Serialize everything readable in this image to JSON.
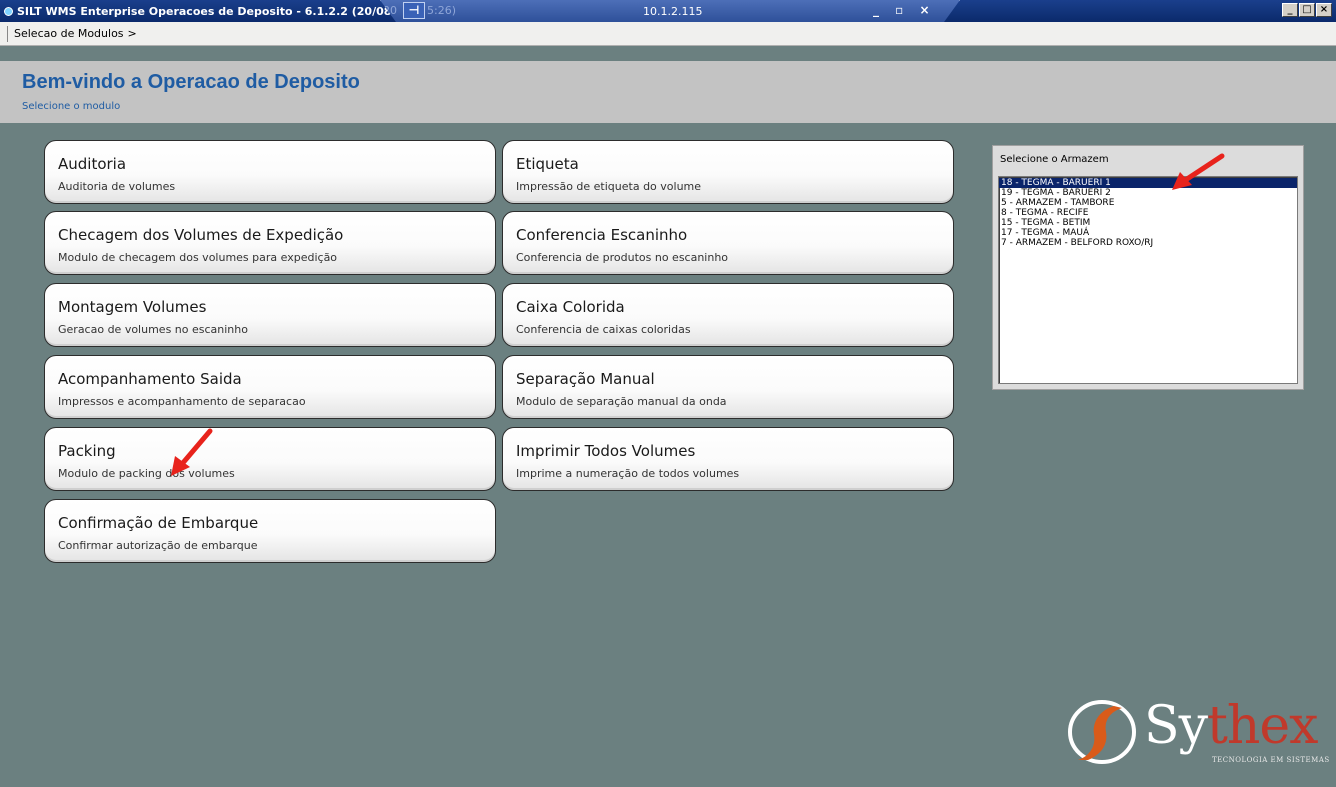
{
  "window": {
    "title": "SILT WMS Enterprise Operacoes de Deposito - 6.1.2.2 (20/08/",
    "title_overlap": "20",
    "title_tail": "5:26)",
    "rdp_ip": "10.1.2.115",
    "rdp_controls": "_ ▫ ×",
    "win_min": "_",
    "win_max": "□",
    "win_close": "×"
  },
  "breadcrumb": {
    "item": "Selecao de Modulos",
    "separator": ">"
  },
  "header": {
    "title": "Bem-vindo a Operacao de Deposito",
    "subtitle": "Selecione o modulo"
  },
  "modules": [
    {
      "title": "Auditoria",
      "desc": "Auditoria de volumes"
    },
    {
      "title": "Etiqueta",
      "desc": "Impressão de etiqueta do volume"
    },
    {
      "title": "Checagem dos Volumes de Expedição",
      "desc": "Modulo de checagem dos volumes para expedição"
    },
    {
      "title": "Conferencia Escaninho",
      "desc": "Conferencia de produtos no escaninho"
    },
    {
      "title": "Montagem Volumes",
      "desc": "Geracao de volumes no escaninho"
    },
    {
      "title": "Caixa Colorida",
      "desc": "Conferencia de caixas coloridas"
    },
    {
      "title": "Acompanhamento Saida",
      "desc": "Impressos e acompanhamento de separacao"
    },
    {
      "title": "Separação Manual",
      "desc": "Modulo de separação manual da onda"
    },
    {
      "title": "Packing",
      "desc": "Modulo de packing dos volumes"
    },
    {
      "title": "Imprimir Todos Volumes",
      "desc": "Imprime a numeração de todos volumes"
    },
    {
      "title": "Confirmação de Embarque",
      "desc": "Confirmar autorização de embarque"
    }
  ],
  "warehouse": {
    "label": "Selecione o Armazem",
    "items": [
      "18 - TEGMA - BARUERI 1",
      "19 - TEGMA - BARUERI 2",
      "5 - ARMAZEM - TAMBORE",
      "8 - TEGMA - RECIFE",
      "15 - TEGMA - BETIM",
      "17 - TEGMA - MAUÁ",
      "7 - ARMAZEM - BELFORD ROXO/RJ"
    ],
    "selected": "18 - TEGMA - BARUERI 1"
  },
  "logo": {
    "word_start": "Sy",
    "word_accent": "thex",
    "tagline": "TECNOLOGIA EM SISTEMAS"
  },
  "colors": {
    "background": "#6b8080",
    "title_blue": "#1f5ca3",
    "selection": "#0a246a",
    "arrow": "#e8231c"
  }
}
